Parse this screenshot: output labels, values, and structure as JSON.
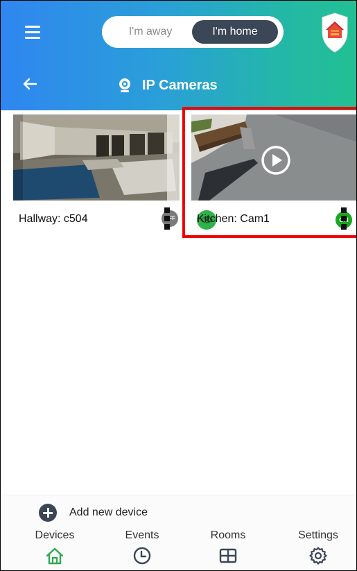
{
  "header": {
    "mode_toggle": {
      "away_label": "I'm away",
      "home_label": "I'm home",
      "selected": "home"
    },
    "title": "IP Cameras",
    "colors": {
      "gradient_start": "#2f86f0",
      "gradient_end": "#22c093",
      "toggle_active": "#3b4656",
      "shield_red": "#e63b3b"
    }
  },
  "cameras": [
    {
      "name": "Hallway: c504",
      "status": "OFF",
      "status_color": "#7a7a7a"
    },
    {
      "name": "Kitchen: Cam1",
      "status": "ON",
      "status_color": "#19a81f",
      "highlighted": true
    }
  ],
  "add_device": {
    "label": "Add new device"
  },
  "bottom_nav": [
    {
      "label": "Devices",
      "icon": "home-icon",
      "active": true,
      "color": "#2fa84f"
    },
    {
      "label": "Events",
      "icon": "clock-icon",
      "active": false,
      "color": "#3b4656"
    },
    {
      "label": "Rooms",
      "icon": "grid-icon",
      "active": false,
      "color": "#3b4656"
    },
    {
      "label": "Settings",
      "icon": "gear-icon",
      "active": false,
      "color": "#3b4656"
    }
  ]
}
